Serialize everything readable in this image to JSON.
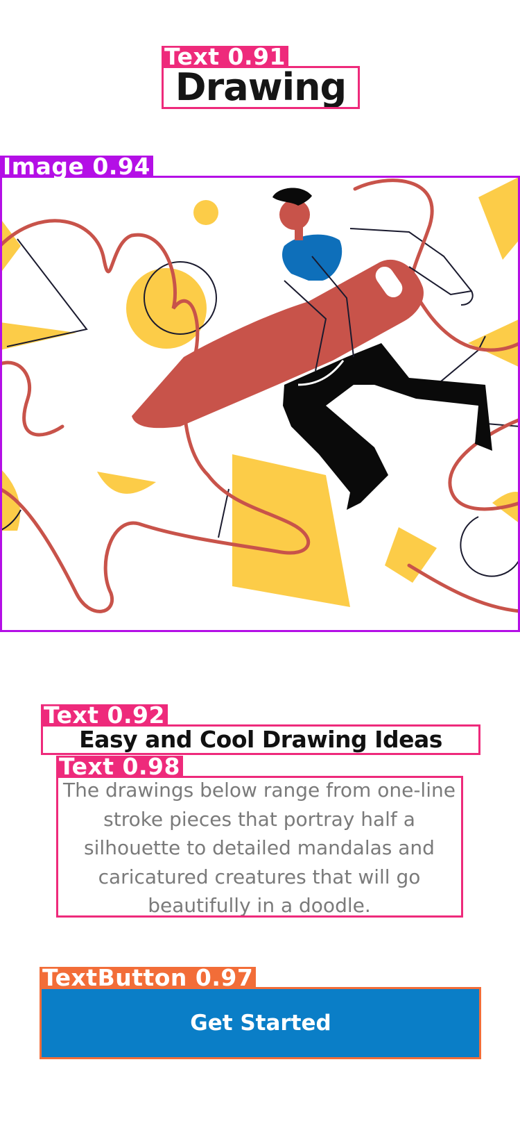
{
  "page": {
    "title": "Drawing",
    "hero_image": "drawing-illustration",
    "heading": "Easy and Cool Drawing Ideas",
    "description": "The drawings below range from one-line stroke pieces that portray half a silhouette to detailed mandalas and caricatured creatures that will go beautifully in a doodle.",
    "cta_label": "Get Started"
  },
  "detections": [
    {
      "class": "Text",
      "score": "0.91",
      "label": "Text 0.91"
    },
    {
      "class": "Image",
      "score": "0.94",
      "label": "Image 0.94"
    },
    {
      "class": "Text",
      "score": "0.92",
      "label": "Text 0.92"
    },
    {
      "class": "Text",
      "score": "0.98",
      "label": "Text 0.98"
    },
    {
      "class": "TextButton",
      "score": "0.97",
      "label": "TextButton 0.97"
    }
  ],
  "colors": {
    "text_box": "#ee2a7b",
    "image_box": "#b40fe6",
    "button_box": "#f26d38",
    "button_fill": "#0a7ec7",
    "illustration_red": "#c8534a",
    "illustration_yellow": "#fccc48",
    "illustration_blue": "#0e6fba"
  }
}
